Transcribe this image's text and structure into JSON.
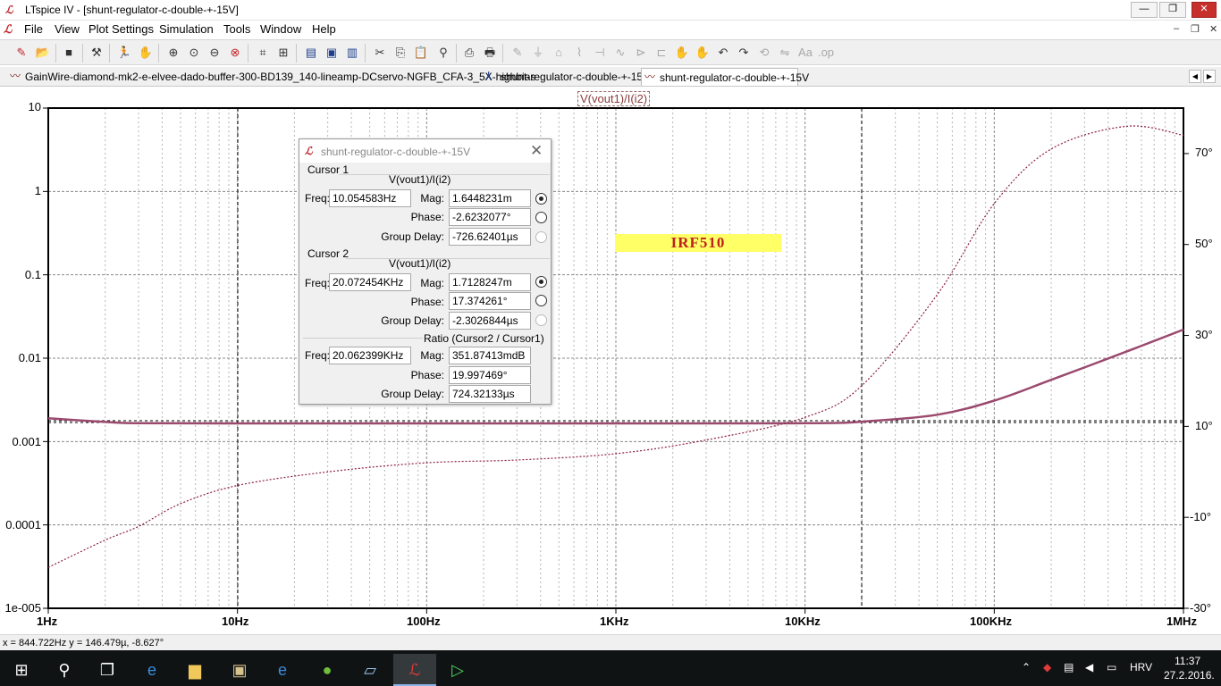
{
  "window": {
    "title": "LTspice IV - [shunt-regulator-c-double-+-15V]",
    "minimize": "—",
    "restore": "❐",
    "close": "✕",
    "mdi_min": "–",
    "mdi_restore": "❐",
    "mdi_close": "✕"
  },
  "menu": [
    "File",
    "View",
    "Plot Settings",
    "Simulation",
    "Tools",
    "Window",
    "Help"
  ],
  "tabs": [
    {
      "label": "GainWire-diamond-mk2-e-elvee-dado-buffer-300-BD139_140-lineamp-DCservo-NGFB_CFA-3_5X-highbias",
      "icon": "waveform-icon"
    },
    {
      "label": "shunt-regulator-c-double-+-15V",
      "icon": "schematic-icon"
    },
    {
      "label": "shunt-regulator-c-double-+-15V",
      "icon": "waveform-icon"
    }
  ],
  "plot": {
    "trace_label": "V(vout1)/I(i2)",
    "left_axis_ticks": [
      "10",
      "1",
      "0.1",
      "0.01",
      "0.001",
      "0.0001",
      "1e-005"
    ],
    "right_axis_ticks": [
      "70°",
      "50°",
      "30°",
      "10°",
      "-10°",
      "-30°"
    ],
    "x_axis_ticks": [
      "1Hz",
      "10Hz",
      "100Hz",
      "1KHz",
      "10KHz",
      "100KHz",
      "1MHz"
    ],
    "annotation": "IRF510",
    "trace_color": "#9b4a6e",
    "phase_color": "#8b2040"
  },
  "chart_data": {
    "type": "line",
    "xscale": "log",
    "yscale": "log",
    "x_range_hz": [
      1,
      1000000
    ],
    "ylim": [
      1e-05,
      10
    ],
    "y2lim_deg": [
      -30,
      80
    ],
    "series": [
      {
        "name": "V(vout1)/I(i2)",
        "axis": "left",
        "style": "solid",
        "x": [
          1,
          2,
          3,
          10,
          100,
          1000,
          10000,
          20000,
          50000,
          100000,
          200000,
          500000,
          1000000
        ],
        "values": [
          0.0019,
          0.00172,
          0.00166,
          0.00165,
          0.00165,
          0.00165,
          0.00166,
          0.00173,
          0.0021,
          0.0031,
          0.0055,
          0.012,
          0.022
        ]
      },
      {
        "name": "V(vout1)/I(i2)",
        "axis": "right",
        "style": "dashed",
        "x": [
          1,
          2,
          3,
          5,
          10,
          30,
          100,
          300,
          1000,
          3000,
          10000,
          20000,
          50000,
          100000,
          200000,
          500000,
          1000000
        ],
        "values": [
          -21,
          -15,
          -12,
          -7,
          -3,
          0,
          2,
          2.6,
          4,
          7,
          12,
          19,
          39,
          59,
          71,
          76,
          74
        ]
      }
    ],
    "grid": true
  },
  "cursor_dialog": {
    "title": "shunt-regulator-c-double-+-15V",
    "close": "✕",
    "cursor1": {
      "group_label": "Cursor 1",
      "trace": "V(vout1)/I(i2)",
      "freq_label": "Freq:",
      "freq": "10.054583Hz",
      "mag_label": "Mag:",
      "mag": "1.6448231m",
      "phase_label": "Phase:",
      "phase": "-2.6232077°",
      "gd_label": "Group Delay:",
      "gd": "-726.62401µs"
    },
    "cursor2": {
      "group_label": "Cursor 2",
      "trace": "V(vout1)/I(i2)",
      "freq_label": "Freq:",
      "freq": "20.072454KHz",
      "mag_label": "Mag:",
      "mag": "1.7128247m",
      "phase_label": "Phase:",
      "phase": "17.374261°",
      "gd_label": "Group Delay:",
      "gd": "-2.3026844µs"
    },
    "ratio": {
      "group_label": "Ratio (Cursor2 / Cursor1)",
      "freq_label": "Freq:",
      "freq": "20.062399KHz",
      "mag_label": "Mag:",
      "mag": "351.87413mdB",
      "phase_label": "Phase:",
      "phase": "19.997469°",
      "gd_label": "Group Delay:",
      "gd": "724.32133µs"
    }
  },
  "status": "x = 844.722Hz    y = 146.479µ, -8.627°",
  "taskbar": {
    "language": "HRV",
    "time": "11:37",
    "date": "27.2.2016."
  }
}
